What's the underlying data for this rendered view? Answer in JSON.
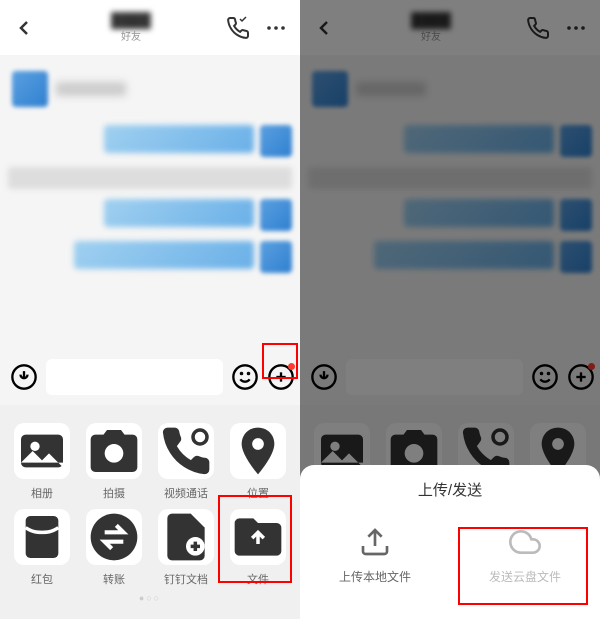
{
  "header": {
    "subtitle": "好友"
  },
  "actions": [
    {
      "label": "相册",
      "icon": "photo"
    },
    {
      "label": "拍摄",
      "icon": "camera"
    },
    {
      "label": "视频通话",
      "icon": "video-call"
    },
    {
      "label": "位置",
      "icon": "location"
    },
    {
      "label": "红包",
      "icon": "red-packet"
    },
    {
      "label": "转账",
      "icon": "transfer"
    },
    {
      "label": "钉钉文档",
      "icon": "doc"
    },
    {
      "label": "文件",
      "icon": "file"
    }
  ],
  "sheet": {
    "title": "上传/发送",
    "local": "上传本地文件",
    "cloud": "发送云盘文件"
  }
}
